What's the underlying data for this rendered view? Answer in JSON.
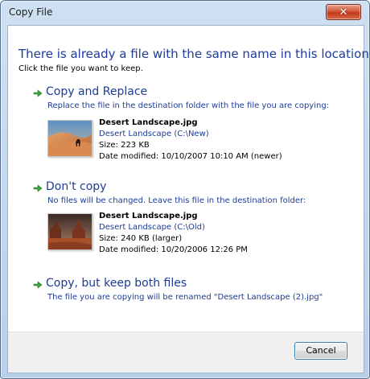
{
  "window": {
    "title": "Copy File",
    "close_icon": "close-icon"
  },
  "content": {
    "main_instruction": "There is already a file with the same name in this location",
    "sub_instruction": "Click the file you want to keep."
  },
  "options": {
    "replace": {
      "title": "Copy and Replace",
      "description": "Replace the file in the destination folder with the file you are copying:",
      "file": {
        "name": "Desert Landscape.jpg",
        "location": "Desert Landscape (C:\\New)",
        "size": "Size: 223 KB",
        "modified": "Date modified: 10/10/2007 10:10 AM (newer)"
      }
    },
    "dont_copy": {
      "title": "Don't copy",
      "description": "No files will be changed. Leave this file in the destination folder:",
      "file": {
        "name": "Desert Landscape.jpg",
        "location": "Desert Landscape (C:\\Old)",
        "size": "Size: 240 KB (larger)",
        "modified": "Date modified: 10/20/2006 12:26 PM"
      }
    },
    "keep_both": {
      "title": "Copy, but keep both files",
      "description": "The file you are copying will be renamed \"Desert Landscape (2).jpg\""
    }
  },
  "footer": {
    "cancel_label": "Cancel"
  },
  "icons": {
    "option_arrow": "green-arrow-icon"
  },
  "colors": {
    "link_blue": "#1e3c96",
    "arrow_green": "#3aa53a",
    "close_red": "#c2381b"
  }
}
